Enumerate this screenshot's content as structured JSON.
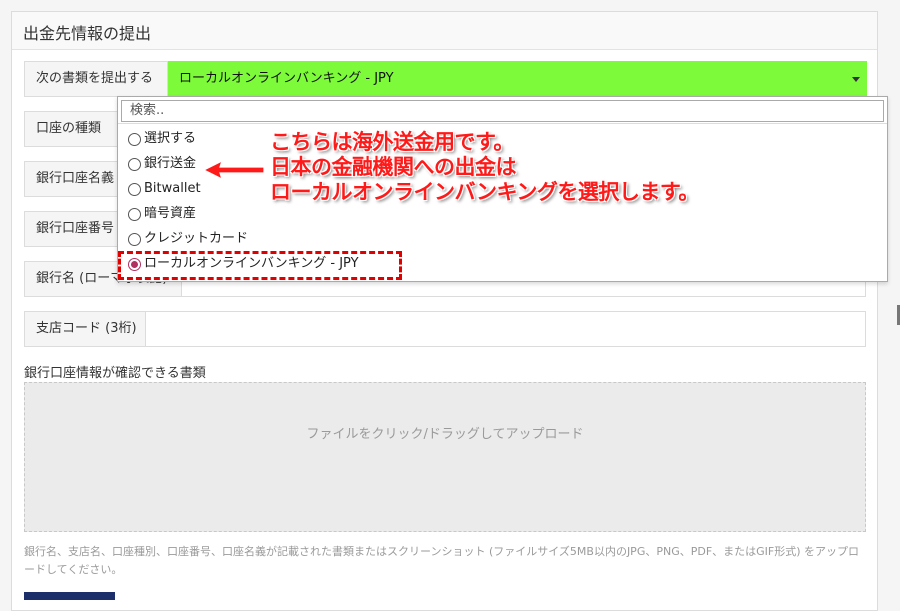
{
  "panel": {
    "title": "出金先情報の提出"
  },
  "form": {
    "document_label": "次の書類を提出する",
    "document_value": "ローカルオンラインバンキング - JPY",
    "account_type_label": "口座の種類",
    "account_name_label": "銀行口座名義",
    "account_number_label": "銀行口座番号",
    "bank_name_label": "銀行名 (ローマ字表記)",
    "branch_code_label": "支店コード (3桁)"
  },
  "dropdown": {
    "search_placeholder": "検索..",
    "options": [
      {
        "label": "選択する",
        "selected": false
      },
      {
        "label": "銀行送金",
        "selected": false
      },
      {
        "label": "Bitwallet",
        "selected": false
      },
      {
        "label": "暗号資産",
        "selected": false
      },
      {
        "label": "クレジットカード",
        "selected": false
      },
      {
        "label": "ローカルオンラインバンキング - JPY",
        "selected": true
      }
    ]
  },
  "annotation": {
    "line1": "こちらは海外送金用です。",
    "line2": "日本の金融機関への出金は",
    "line3": "ローカルオンラインバンキングを選択します。",
    "color": "#ff1a1a"
  },
  "upload": {
    "section_title": "銀行口座情報が確認できる書類",
    "dropzone_text": "ファイルをクリック/ドラッグしてアップロード",
    "help_text": "銀行名、支店名、口座種別、口座番号、口座名義が記載された書類またはスクリーンショット (ファイルサイズ5MB以内のJPG、PNG、PDF、またはGIF形式) をアップロードしてください。"
  },
  "colors": {
    "select_bg": "#7dfa3a",
    "accent": "#b03060",
    "submit": "#1c2f6b"
  }
}
